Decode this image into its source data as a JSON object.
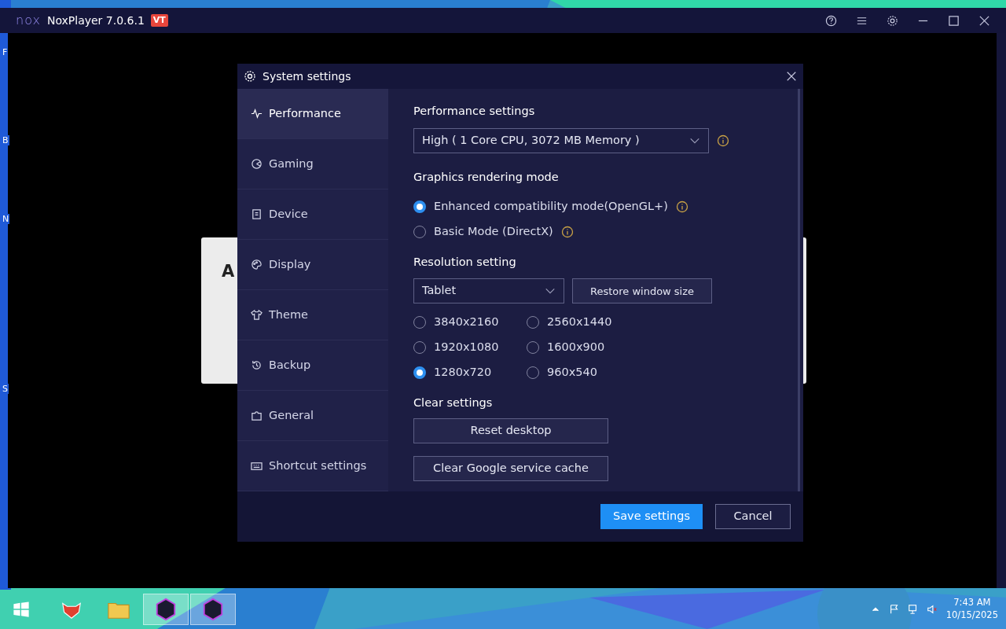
{
  "window": {
    "logo": "nox",
    "title": "NoxPlayer 7.0.6.1",
    "badge": "VT"
  },
  "desktop_edge_labels": [
    "F",
    "B",
    "N",
    "S"
  ],
  "background_card": {
    "text": "A"
  },
  "dialog": {
    "title": "System settings",
    "sidebar": {
      "items": [
        {
          "label": "Performance",
          "selected": true
        },
        {
          "label": "Gaming",
          "selected": false
        },
        {
          "label": "Device",
          "selected": false
        },
        {
          "label": "Display",
          "selected": false
        },
        {
          "label": "Theme",
          "selected": false
        },
        {
          "label": "Backup",
          "selected": false
        },
        {
          "label": "General",
          "selected": false
        },
        {
          "label": "Shortcut settings",
          "selected": false
        }
      ]
    },
    "performance": {
      "heading": "Performance settings",
      "value": "High ( 1 Core CPU, 3072 MB Memory )"
    },
    "graphics": {
      "heading": "Graphics rendering mode",
      "options": [
        {
          "label": "Enhanced compatibility mode(OpenGL+)",
          "selected": true
        },
        {
          "label": "Basic Mode (DirectX)",
          "selected": false
        }
      ]
    },
    "resolution": {
      "heading": "Resolution setting",
      "value": "Tablet",
      "restore_button": "Restore window size",
      "options": [
        {
          "label": "3840x2160",
          "selected": false
        },
        {
          "label": "2560x1440",
          "selected": false
        },
        {
          "label": "1920x1080",
          "selected": false
        },
        {
          "label": "1600x900",
          "selected": false
        },
        {
          "label": "1280x720",
          "selected": true
        },
        {
          "label": "960x540",
          "selected": false
        }
      ]
    },
    "clear": {
      "heading": "Clear settings",
      "buttons": [
        "Reset desktop",
        "Clear Google service cache"
      ]
    },
    "footer": {
      "buttons": [
        {
          "label": "Save settings",
          "kind": "primary"
        },
        {
          "label": "Cancel",
          "kind": "secondary"
        }
      ]
    }
  },
  "taskbar": {
    "time": "7:43 AM",
    "date": "10/15/2025"
  }
}
